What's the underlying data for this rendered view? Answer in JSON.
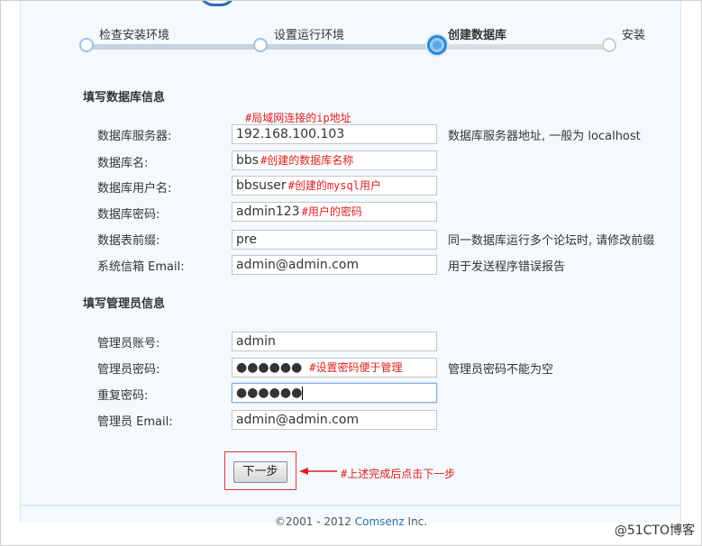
{
  "steps": [
    {
      "label": "检查安装环境",
      "state": "done"
    },
    {
      "label": "设置运行环境",
      "state": "done"
    },
    {
      "label": "创建数据库",
      "state": "active"
    },
    {
      "label": "安装",
      "state": "pending"
    }
  ],
  "db_section": {
    "title": "填写数据库信息",
    "server_annotation": "#局域网连接的ip地址",
    "rows": [
      {
        "label": "数据库服务器:",
        "value": "192.168.100.103",
        "note": "",
        "hint": "数据库服务器地址, 一般为 localhost"
      },
      {
        "label": "数据库名:",
        "value": "bbs",
        "note": "#创建的数据库名称",
        "hint": ""
      },
      {
        "label": "数据库用户名:",
        "value": "bbsuser",
        "note": "#创建的mysql用户",
        "hint": ""
      },
      {
        "label": "数据库密码:",
        "value": "admin123",
        "note": "#用户的密码",
        "hint": ""
      },
      {
        "label": "数据表前缀:",
        "value": "pre",
        "note": "",
        "hint": "同一数据库运行多个论坛时, 请修改前缀"
      },
      {
        "label": "系统信箱 Email:",
        "value": "admin@admin.com",
        "note": "",
        "hint": "用于发送程序错误报告"
      }
    ]
  },
  "admin_section": {
    "title": "填写管理员信息",
    "rows": [
      {
        "label": "管理员账号:",
        "value": "admin",
        "note": "",
        "hint": ""
      },
      {
        "label": "管理员密码:",
        "value": "●●●●●●",
        "note": "#设置密码便于管理",
        "hint": "管理员密码不能为空"
      },
      {
        "label": "重复密码:",
        "value": "●●●●●●",
        "note": "",
        "hint": ""
      },
      {
        "label": "管理员 Email:",
        "value": "admin@admin.com",
        "note": "",
        "hint": ""
      }
    ]
  },
  "next_button": {
    "label": "下一步"
  },
  "next_annotation": "#上述完成后点击下一步",
  "footer": {
    "prefix": "©2001 - 2012 ",
    "brand": "Comsenz",
    "suffix": " Inc."
  },
  "watermark": "@51CTO博客",
  "colors": {
    "annotation": "#e02020",
    "accent": "#2e86d1",
    "brand": "#2b6fb1"
  }
}
